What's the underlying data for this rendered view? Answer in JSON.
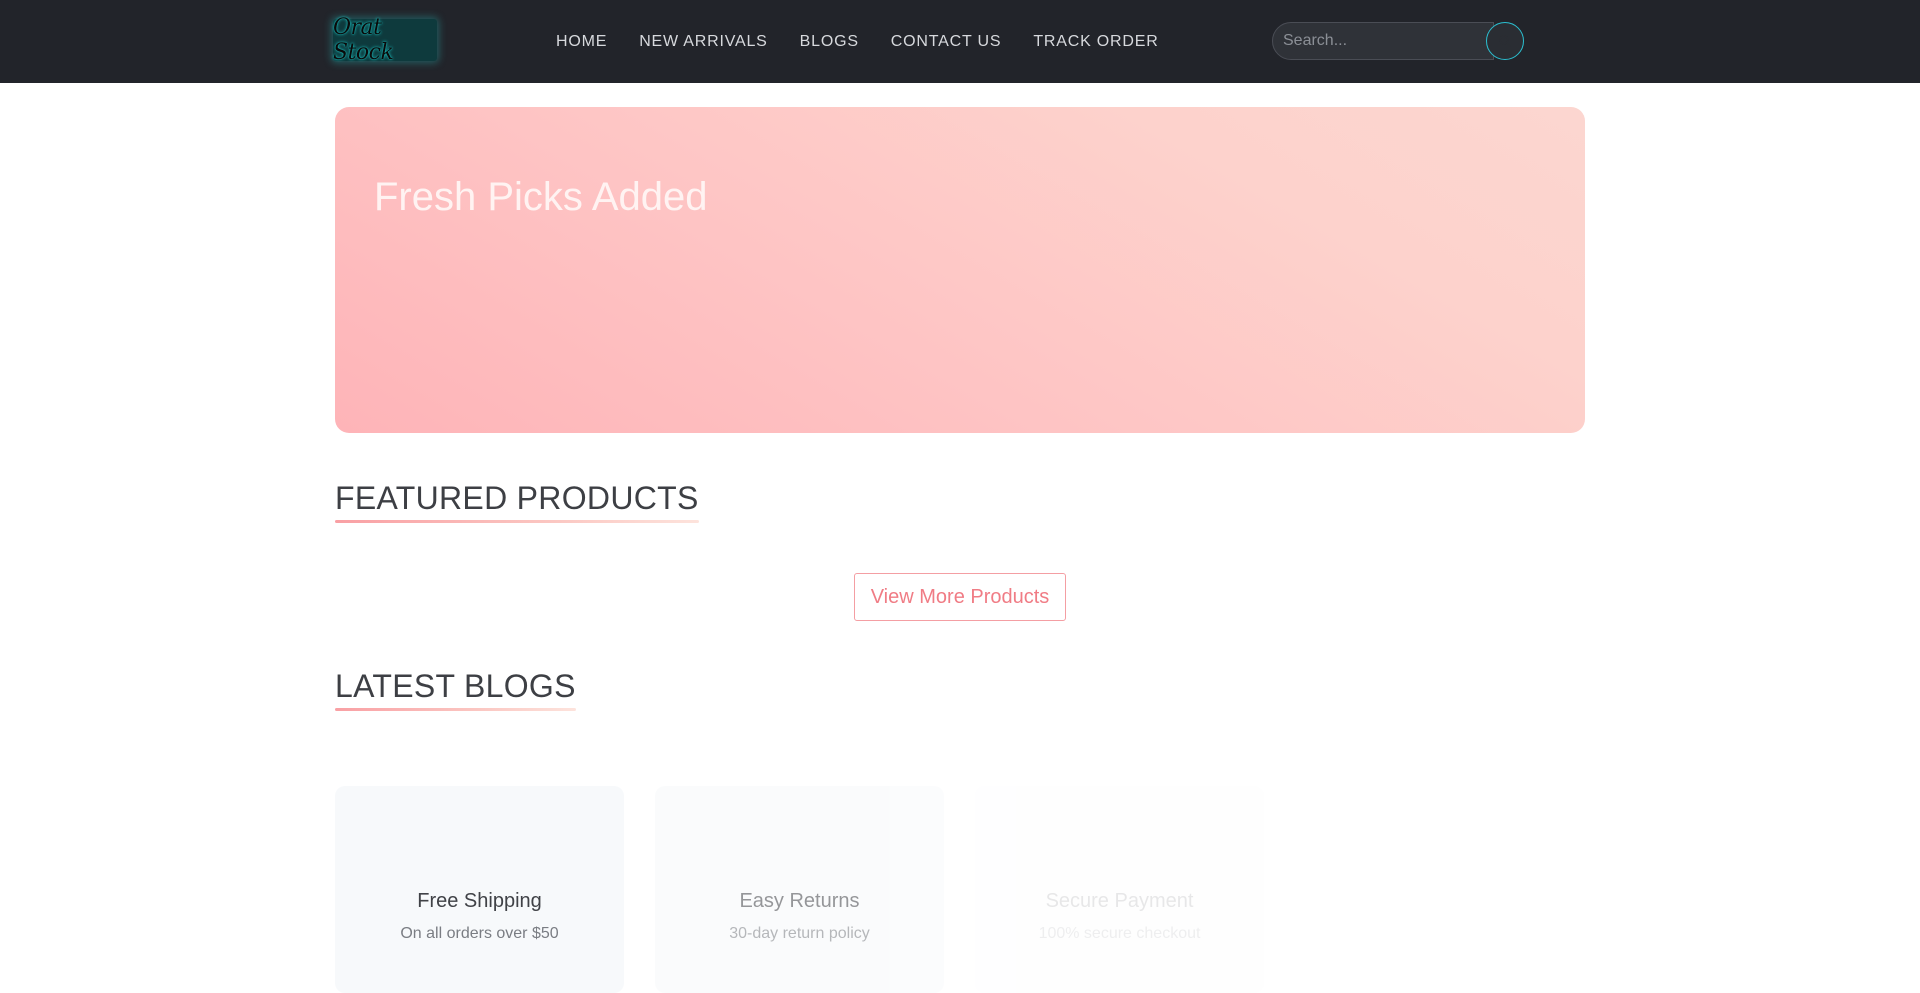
{
  "header": {
    "logo_text": "Orat Stock",
    "nav": [
      {
        "label": "HOME"
      },
      {
        "label": "NEW ARRIVALS"
      },
      {
        "label": "BLOGS"
      },
      {
        "label": "CONTACT US"
      },
      {
        "label": "TRACK ORDER"
      }
    ],
    "search": {
      "placeholder": "Search...",
      "value": ""
    }
  },
  "hero": {
    "title": "Fresh Picks Added"
  },
  "featured": {
    "title": "FEATURED PRODUCTS",
    "view_more_label": "View More Products"
  },
  "blogs": {
    "title": "LATEST BLOGS"
  },
  "features": [
    {
      "title": "Free Shipping",
      "desc": "On all orders over $50"
    },
    {
      "title": "Easy Returns",
      "desc": "30-day return policy"
    },
    {
      "title": "Secure Payment",
      "desc": "100% secure checkout"
    }
  ],
  "colors": {
    "header_bg": "#22242a",
    "accent": "#f07c85",
    "search_accent": "#2bbfd0"
  }
}
